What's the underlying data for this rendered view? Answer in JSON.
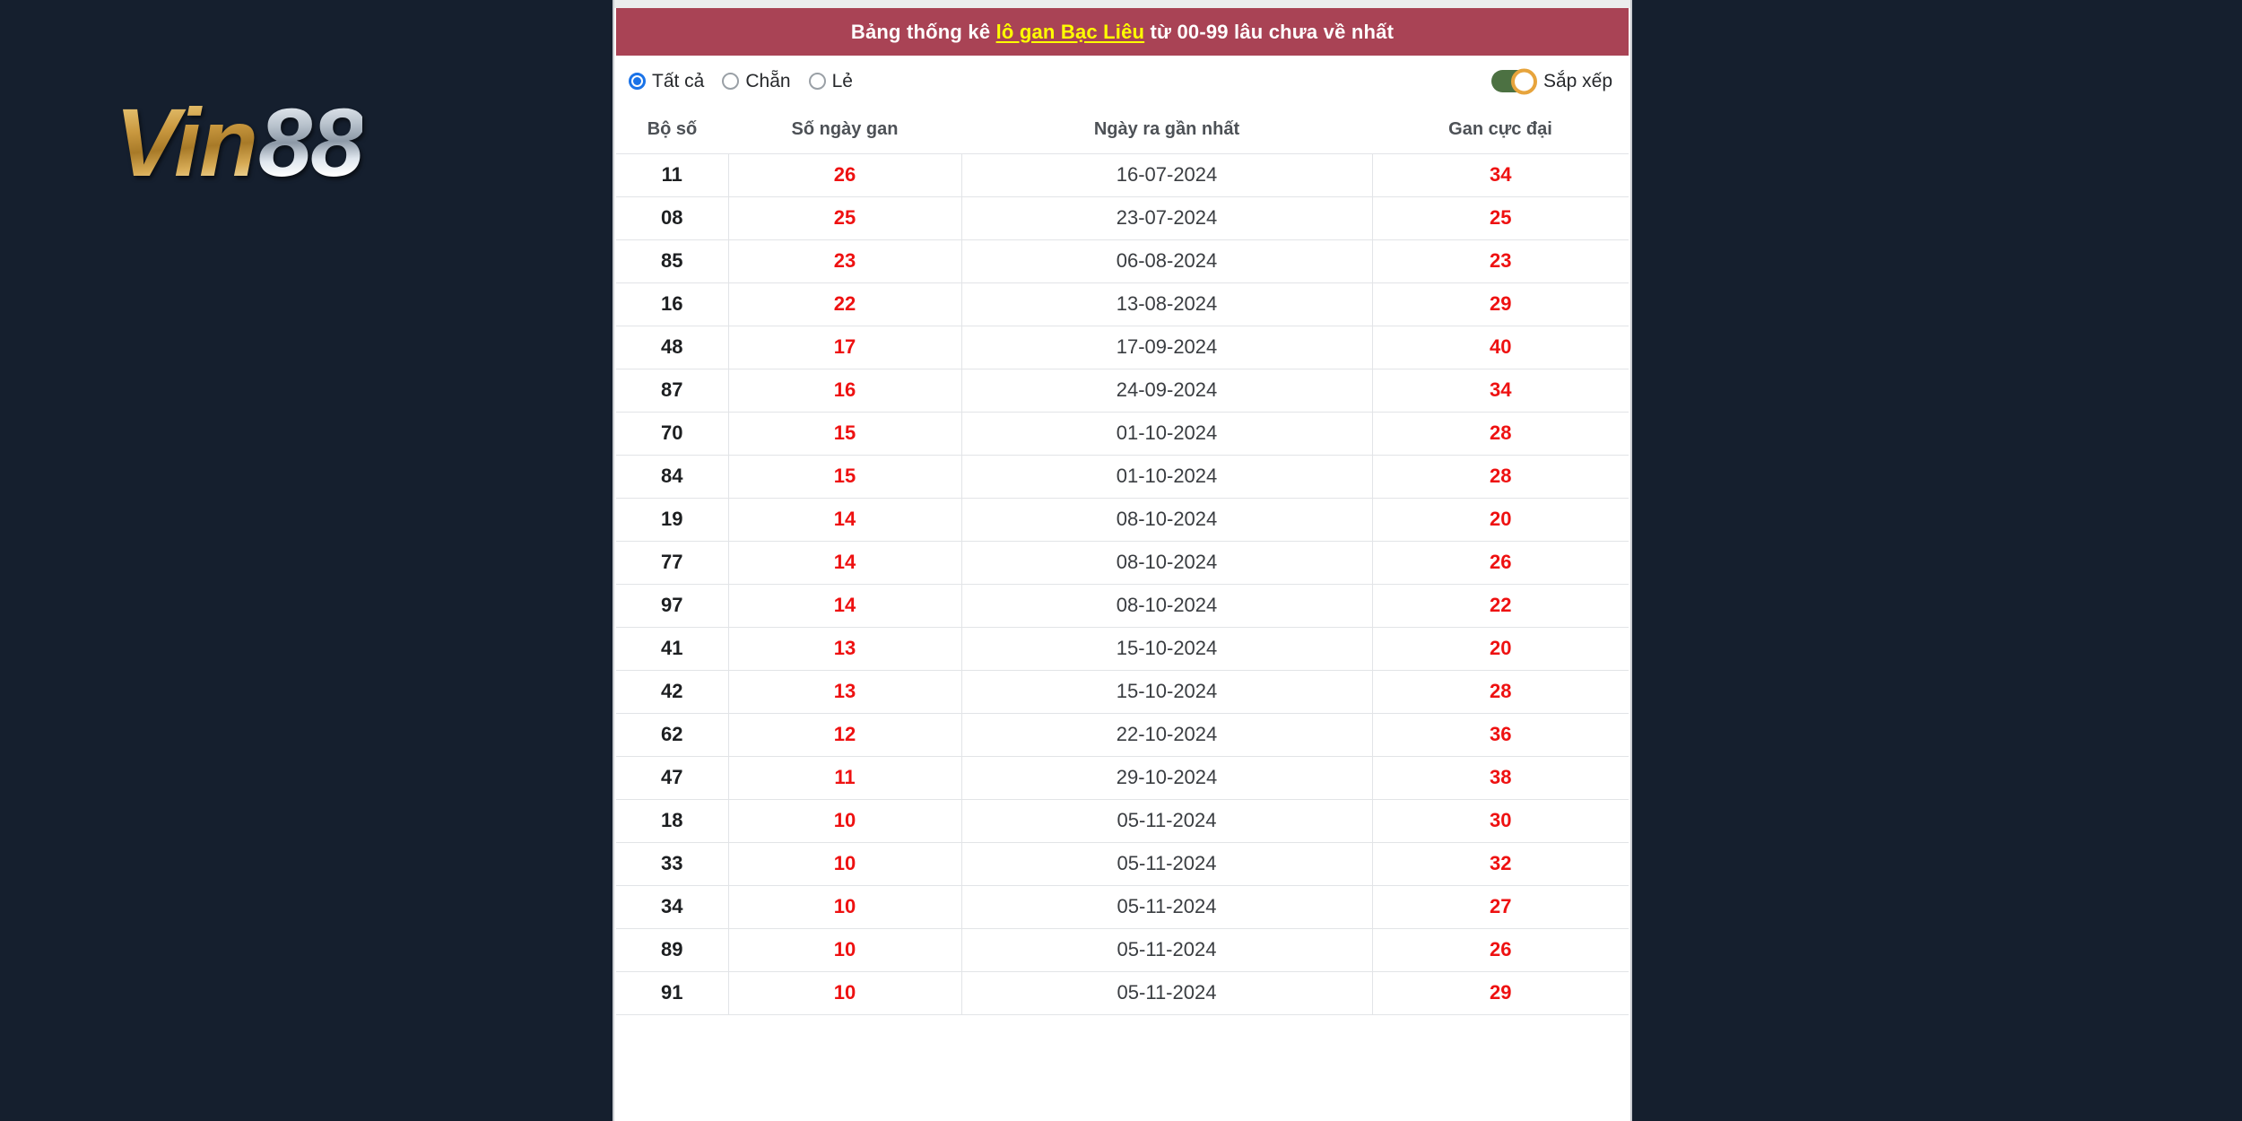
{
  "brand": {
    "logo_primary": "Vin",
    "logo_secondary": "88"
  },
  "banner": {
    "prefix": "Bảng thống kê ",
    "link": "lô gan Bạc Liêu",
    "suffix": " từ 00-99 lâu chưa về nhất",
    "background_color": "#a94355",
    "text_color": "#ffffff",
    "link_color": "#ffff00"
  },
  "filters": {
    "options": [
      {
        "label": "Tất cả",
        "checked": true
      },
      {
        "label": "Chẵn",
        "checked": false
      },
      {
        "label": "Lẻ",
        "checked": false
      }
    ],
    "selected": "Tất cả",
    "accent_color": "#1a73e8"
  },
  "sort": {
    "label": "Sắp xếp",
    "enabled": true,
    "track_color": "#4c7142",
    "knob_color": "#e7a43c"
  },
  "table": {
    "columns": [
      "Bộ số",
      "Số ngày gan",
      "Ngày ra gần nhất",
      "Gan cực đại"
    ],
    "highlight_color": "#ee1111",
    "rows": [
      {
        "bo_so": "11",
        "so_ngay_gan": "26",
        "ngay_ra": "16-07-2024",
        "gan_cuc_dai": "34"
      },
      {
        "bo_so": "08",
        "so_ngay_gan": "25",
        "ngay_ra": "23-07-2024",
        "gan_cuc_dai": "25"
      },
      {
        "bo_so": "85",
        "so_ngay_gan": "23",
        "ngay_ra": "06-08-2024",
        "gan_cuc_dai": "23"
      },
      {
        "bo_so": "16",
        "so_ngay_gan": "22",
        "ngay_ra": "13-08-2024",
        "gan_cuc_dai": "29"
      },
      {
        "bo_so": "48",
        "so_ngay_gan": "17",
        "ngay_ra": "17-09-2024",
        "gan_cuc_dai": "40"
      },
      {
        "bo_so": "87",
        "so_ngay_gan": "16",
        "ngay_ra": "24-09-2024",
        "gan_cuc_dai": "34"
      },
      {
        "bo_so": "70",
        "so_ngay_gan": "15",
        "ngay_ra": "01-10-2024",
        "gan_cuc_dai": "28"
      },
      {
        "bo_so": "84",
        "so_ngay_gan": "15",
        "ngay_ra": "01-10-2024",
        "gan_cuc_dai": "28"
      },
      {
        "bo_so": "19",
        "so_ngay_gan": "14",
        "ngay_ra": "08-10-2024",
        "gan_cuc_dai": "20"
      },
      {
        "bo_so": "77",
        "so_ngay_gan": "14",
        "ngay_ra": "08-10-2024",
        "gan_cuc_dai": "26"
      },
      {
        "bo_so": "97",
        "so_ngay_gan": "14",
        "ngay_ra": "08-10-2024",
        "gan_cuc_dai": "22"
      },
      {
        "bo_so": "41",
        "so_ngay_gan": "13",
        "ngay_ra": "15-10-2024",
        "gan_cuc_dai": "20"
      },
      {
        "bo_so": "42",
        "so_ngay_gan": "13",
        "ngay_ra": "15-10-2024",
        "gan_cuc_dai": "28"
      },
      {
        "bo_so": "62",
        "so_ngay_gan": "12",
        "ngay_ra": "22-10-2024",
        "gan_cuc_dai": "36"
      },
      {
        "bo_so": "47",
        "so_ngay_gan": "11",
        "ngay_ra": "29-10-2024",
        "gan_cuc_dai": "38"
      },
      {
        "bo_so": "18",
        "so_ngay_gan": "10",
        "ngay_ra": "05-11-2024",
        "gan_cuc_dai": "30"
      },
      {
        "bo_so": "33",
        "so_ngay_gan": "10",
        "ngay_ra": "05-11-2024",
        "gan_cuc_dai": "32"
      },
      {
        "bo_so": "34",
        "so_ngay_gan": "10",
        "ngay_ra": "05-11-2024",
        "gan_cuc_dai": "27"
      },
      {
        "bo_so": "89",
        "so_ngay_gan": "10",
        "ngay_ra": "05-11-2024",
        "gan_cuc_dai": "26"
      },
      {
        "bo_so": "91",
        "so_ngay_gan": "10",
        "ngay_ra": "05-11-2024",
        "gan_cuc_dai": "29"
      }
    ]
  },
  "theme": {
    "page_background": "#151f2e",
    "panel_background": "#ffffff"
  }
}
